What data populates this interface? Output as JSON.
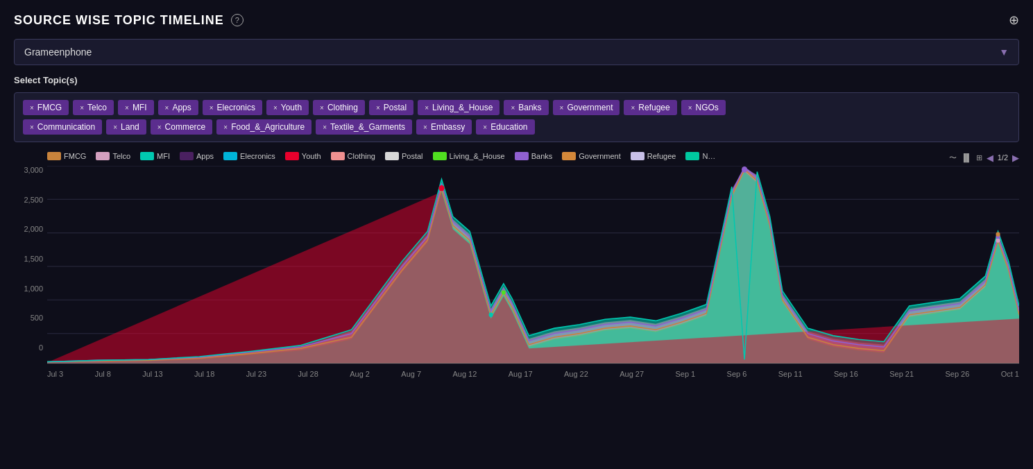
{
  "title": "SOURCE WISE TOPIC TIMELINE",
  "info_icon": "?",
  "zoom_icon": "⊕",
  "dropdown": {
    "selected": "Grameenphone",
    "arrow": "▼"
  },
  "select_topic_label": "Select Topic(s)",
  "topics_row1": [
    {
      "label": "FMCG"
    },
    {
      "label": "Telco"
    },
    {
      "label": "MFI"
    },
    {
      "label": "Apps"
    },
    {
      "label": "Elecronics"
    },
    {
      "label": "Youth"
    },
    {
      "label": "Clothing"
    },
    {
      "label": "Postal"
    },
    {
      "label": "Living_&_House"
    },
    {
      "label": "Banks"
    },
    {
      "label": "Government"
    },
    {
      "label": "Refugee"
    },
    {
      "label": "NGOs"
    }
  ],
  "topics_row2": [
    {
      "label": "Communication"
    },
    {
      "label": "Land"
    },
    {
      "label": "Commerce"
    },
    {
      "label": "Food_&_Agriculture"
    },
    {
      "label": "Textile_&_Garments"
    },
    {
      "label": "Embassy"
    },
    {
      "label": "Education"
    }
  ],
  "legend": [
    {
      "label": "FMCG",
      "color": "#c8833c"
    },
    {
      "label": "Telco",
      "color": "#d4a0c0"
    },
    {
      "label": "MFI",
      "color": "#00c8b0"
    },
    {
      "label": "Apps",
      "color": "#4a2060"
    },
    {
      "label": "Elecronics",
      "color": "#00b4d8"
    },
    {
      "label": "Youth",
      "color": "#e8002c"
    },
    {
      "label": "Clothing",
      "color": "#f09090"
    },
    {
      "label": "Postal",
      "color": "#d8d8d8"
    },
    {
      "label": "Living_&_House",
      "color": "#50e020"
    },
    {
      "label": "Banks",
      "color": "#9060d0"
    },
    {
      "label": "Government",
      "color": "#d4883a"
    },
    {
      "label": "Refugee",
      "color": "#c8c0e8"
    },
    {
      "label": "N…",
      "color": "#00c8a0"
    }
  ],
  "legend_page": "1/2",
  "y_axis": [
    "3,000",
    "2,500",
    "2,000",
    "1,500",
    "1,000",
    "500",
    "0"
  ],
  "x_axis": [
    "Jul 3",
    "Jul 8",
    "Jul 13",
    "Jul 18",
    "Jul 23",
    "Jul 28",
    "Aug 2",
    "Aug 7",
    "Aug 12",
    "Aug 17",
    "Aug 22",
    "Aug 27",
    "Sep 1",
    "Sep 6",
    "Sep 11",
    "Sep 16",
    "Sep 21",
    "Sep 26",
    "Oct 1"
  ]
}
